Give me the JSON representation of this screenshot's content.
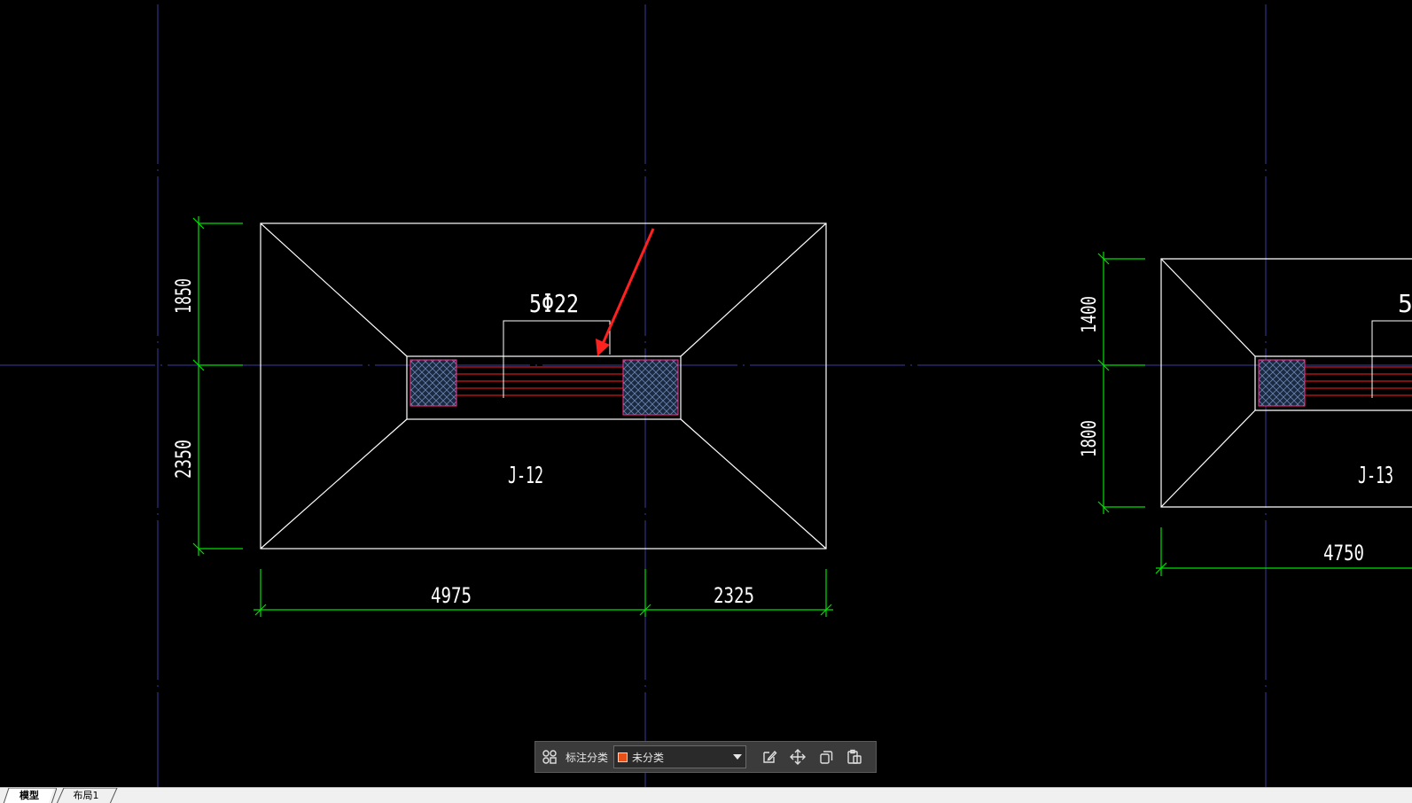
{
  "drawing": {
    "footing1": {
      "label": "J-12",
      "rebar_note": "5Φ22",
      "dim_top": "1850",
      "dim_bottom": "2350",
      "dim_left": "4975",
      "dim_right": "2325"
    },
    "footing2": {
      "label": "J-13",
      "rebar_note_partial": "5",
      "dim_top": "1400",
      "dim_bottom": "1800",
      "dim_left": "4750"
    }
  },
  "annotation_toolbar": {
    "category_label": "标注分类",
    "category_value": "未分类",
    "swatch_color": "#e8501a",
    "buttons": [
      "grid-icon",
      "edit-icon",
      "move-icon",
      "copy-icon",
      "paste-icon"
    ]
  },
  "tabs": {
    "model": "模型",
    "layout1": "布局1"
  },
  "colors": {
    "background": "#000000",
    "grid_line": "#3a3aa0",
    "outline": "#ffffff",
    "dimension": "#00e000",
    "rebar": "#ff2020",
    "column_border": "#ff3090",
    "arrow": "#ff2020"
  }
}
